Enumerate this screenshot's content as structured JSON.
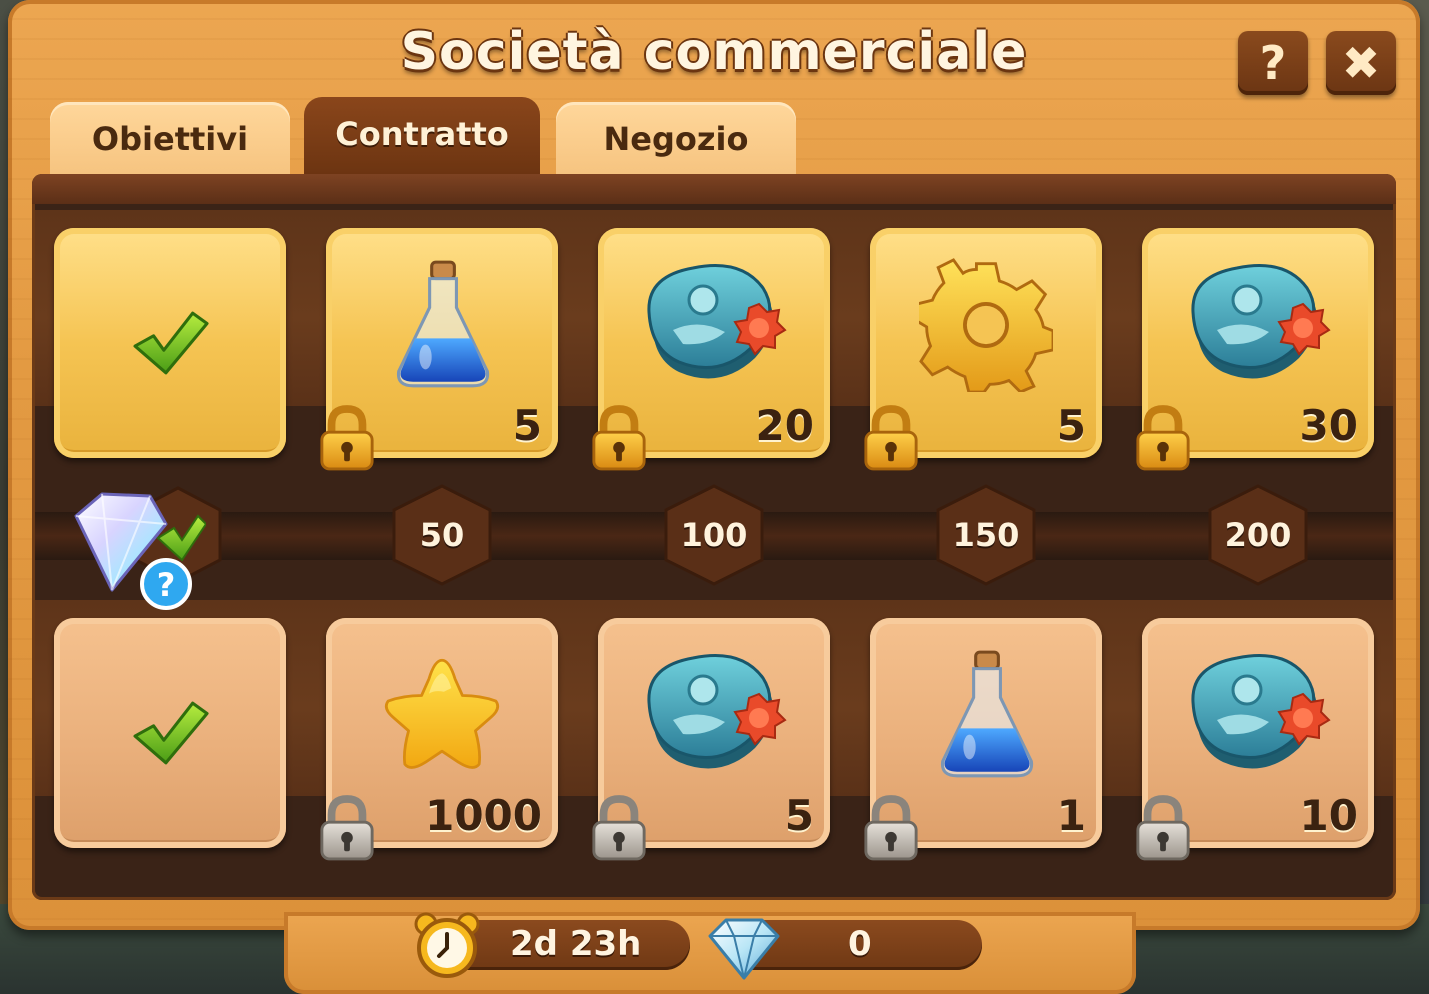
{
  "window": {
    "title": "Società commerciale",
    "help_label": "?",
    "close_label": "✖"
  },
  "tabs": [
    {
      "label": "Obiettivi",
      "active": false
    },
    {
      "label": "Contratto",
      "active": true
    },
    {
      "label": "Negozio",
      "active": false
    }
  ],
  "milestones": [
    "50",
    "100",
    "150",
    "200"
  ],
  "rows": {
    "premium": [
      {
        "item": "check-icon",
        "claimed": true
      },
      {
        "item": "potion-icon",
        "qty": "5",
        "locked": true
      },
      {
        "item": "fossil-card-icon",
        "qty": "20",
        "locked": true
      },
      {
        "item": "gear-icon",
        "qty": "5",
        "locked": true
      },
      {
        "item": "fossil-card-icon",
        "qty": "30",
        "locked": true
      }
    ],
    "free": [
      {
        "item": "check-icon",
        "claimed": true
      },
      {
        "item": "star-icon",
        "qty": "1000",
        "locked": true
      },
      {
        "item": "fossil-card-icon",
        "qty": "5",
        "locked": true
      },
      {
        "item": "potion-icon",
        "qty": "1",
        "locked": true
      },
      {
        "item": "fossil-card-icon",
        "qty": "10",
        "locked": true
      }
    ]
  },
  "footer": {
    "timer": "2d 23h",
    "diamonds": "0"
  }
}
